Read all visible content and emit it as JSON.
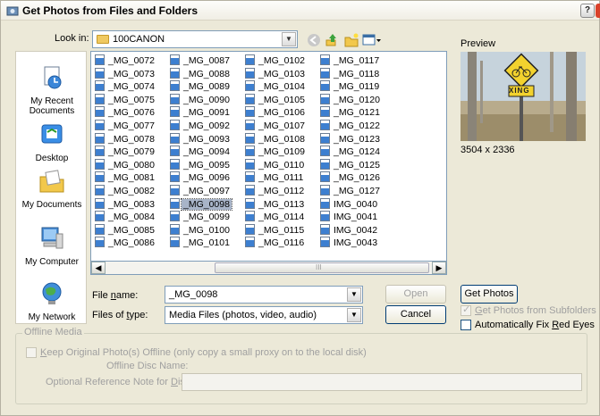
{
  "window": {
    "title": "Get Photos from Files and Folders",
    "help_label": "?"
  },
  "lookin": {
    "label": "Look in:",
    "value": "100CANON"
  },
  "places": [
    {
      "label": "My Recent Documents"
    },
    {
      "label": "Desktop"
    },
    {
      "label": "My Documents"
    },
    {
      "label": "My Computer"
    },
    {
      "label": "My Network"
    }
  ],
  "files": {
    "col1": [
      "_MG_0072",
      "_MG_0073",
      "_MG_0074",
      "_MG_0075",
      "_MG_0076",
      "_MG_0077",
      "_MG_0078",
      "_MG_0079",
      "_MG_0080",
      "_MG_0081",
      "_MG_0082",
      "_MG_0083",
      "_MG_0084",
      "_MG_0085",
      "_MG_0086"
    ],
    "col2": [
      "_MG_0087",
      "_MG_0088",
      "_MG_0089",
      "_MG_0090",
      "_MG_0091",
      "_MG_0092",
      "_MG_0093",
      "_MG_0094",
      "_MG_0095",
      "_MG_0096",
      "_MG_0097",
      "_MG_0098",
      "_MG_0099",
      "_MG_0100",
      "_MG_0101"
    ],
    "col3": [
      "_MG_0102",
      "_MG_0103",
      "_MG_0104",
      "_MG_0105",
      "_MG_0106",
      "_MG_0107",
      "_MG_0108",
      "_MG_0109",
      "_MG_0110",
      "_MG_0111",
      "_MG_0112",
      "_MG_0113",
      "_MG_0114",
      "_MG_0115",
      "_MG_0116"
    ],
    "col4": [
      "_MG_0117",
      "_MG_0118",
      "_MG_0119",
      "_MG_0120",
      "_MG_0121",
      "_MG_0122",
      "_MG_0123",
      "_MG_0124",
      "_MG_0125",
      "_MG_0126",
      "_MG_0127",
      "IMG_0040",
      "IMG_0041",
      "IMG_0042",
      "IMG_0043"
    ],
    "selected": "_MG_0098"
  },
  "scroll_thumb_label": "III",
  "filename": {
    "label": "File name:",
    "value": "_MG_0098"
  },
  "filetype": {
    "label": "Files of type:",
    "value": "Media Files (photos, video, audio)"
  },
  "buttons": {
    "open": "Open",
    "cancel": "Cancel",
    "get_photos": "Get Photos"
  },
  "preview": {
    "label": "Preview",
    "dimensions": "3504 x 2336",
    "sign_text": "XING"
  },
  "options": {
    "subfolders": {
      "label": "Get Photos from Subfolders",
      "checked": true,
      "enabled": false
    },
    "red_eyes": {
      "label": "Automatically Fix Red Eyes",
      "checked": false,
      "enabled": true
    }
  },
  "offline": {
    "group_title": "Offline Media",
    "keep_label": "Keep Original Photo(s) Offline (only copy a small proxy on to the local disk)",
    "disc_name_label": "Offline Disc Name:",
    "note_label": "Optional Reference Note for Disc:"
  }
}
